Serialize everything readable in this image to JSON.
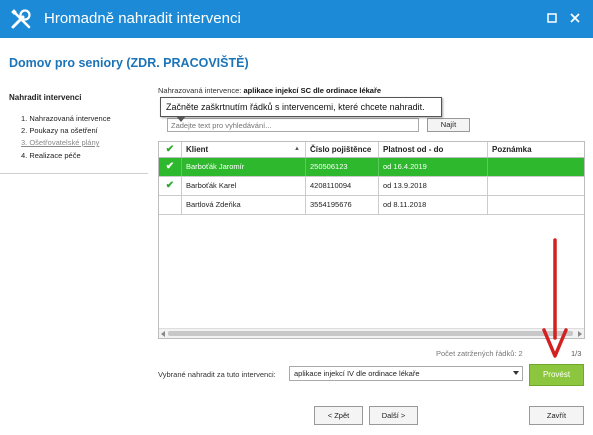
{
  "window": {
    "title": "Hromadně nahradit intervenci",
    "icon": "wrench-screwdriver-icon",
    "accent_color": "#1c8ad6"
  },
  "header": {
    "org_title": "Domov pro seniory (ZDR. PRACOVIŠTĚ)"
  },
  "sidebar": {
    "heading": "Nahradit intervenci",
    "steps": [
      {
        "label": "1. Nahrazovaná intervence",
        "active": true
      },
      {
        "label": "2. Poukazy na ošetření",
        "active": true
      },
      {
        "label": "3. Ošetřovatelské plány",
        "active": false
      },
      {
        "label": "4. Realizace péče",
        "active": true
      }
    ]
  },
  "main": {
    "replaced_label": "Nahrazovaná intervence:",
    "replaced_value": "aplikace injekcí SC dle ordinace lékaře",
    "tooltip": "Začněte zaškrtnutím řádků s intervencemi, které chcete nahradit.",
    "search_placeholder": "Zadejte text pro vyhledávání...",
    "find_button": "Najít"
  },
  "table": {
    "columns": [
      "",
      "Klient",
      "Číslo pojištěnce",
      "Platnost od - do",
      "Poznámka"
    ],
    "rows": [
      {
        "checked": true,
        "selected": true,
        "client": "Barboťák Jaromír",
        "insurance": "250506123",
        "validity": "od 16.4.2019",
        "note": ""
      },
      {
        "checked": true,
        "selected": false,
        "client": "Barboťák Karel",
        "insurance": "4208110094",
        "validity": "od 13.9.2018",
        "note": ""
      },
      {
        "checked": false,
        "selected": false,
        "client": "Bartlová Zdeňka",
        "insurance": "3554195676",
        "validity": "od 8.11.2018",
        "note": ""
      }
    ],
    "selected_row_color": "#2eb82e"
  },
  "footer": {
    "checked_count": "Počet zatržených řádků: 2",
    "pager": "1/3",
    "replace_label": "Vybrané nahradit za tuto intervenci:",
    "replace_value": "aplikace injekcí IV dle ordinace lékaře",
    "run_button": "Provést",
    "run_button_color": "#8cc63f",
    "back_button": "< Zpět",
    "next_button": "Další >",
    "close_button": "Zavřít"
  },
  "annotation": {
    "arrow_color": "#d32020"
  }
}
